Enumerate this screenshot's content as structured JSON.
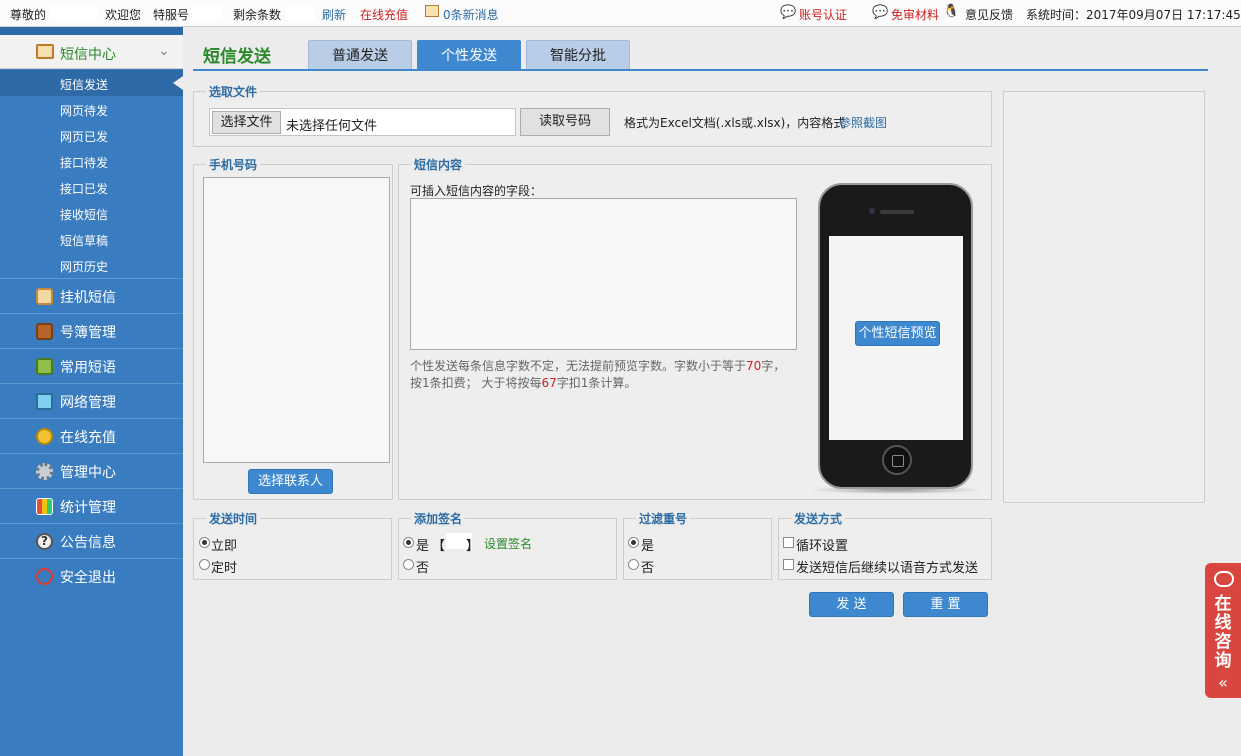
{
  "topbar": {
    "respect": "尊敬的",
    "welcome": "欢迎您",
    "service_no": "特服号",
    "remaining": "剩余条数",
    "refresh": "刷新",
    "recharge": "在线充值",
    "messages": "0条新消息",
    "account_auth": "账号认证",
    "free_material": "免审材料",
    "feedback": "意见反馈",
    "system_time_label": "系统时间：",
    "system_time": "2017年09月07日 17:17:45"
  },
  "sidebar": {
    "section": "短信中心",
    "sub_items": [
      "短信发送",
      "网页待发",
      "网页已发",
      "接口待发",
      "接口已发",
      "接收短信",
      "短信草稿",
      "网页历史"
    ],
    "menu": [
      {
        "label": "挂机短信",
        "icon": "envelope-icon"
      },
      {
        "label": "号簿管理",
        "icon": "book-icon"
      },
      {
        "label": "常用短语",
        "icon": "notepad-icon"
      },
      {
        "label": "网络管理",
        "icon": "monitor-icon"
      },
      {
        "label": "在线充值",
        "icon": "coins-icon"
      },
      {
        "label": "管理中心",
        "icon": "gear-icon"
      },
      {
        "label": "统计管理",
        "icon": "bar-chart-icon"
      },
      {
        "label": "公告信息",
        "icon": "question-icon"
      },
      {
        "label": "安全退出",
        "icon": "power-icon"
      }
    ]
  },
  "main": {
    "title": "短信发送",
    "tabs": [
      "普通发送",
      "个性发送",
      "智能分批"
    ],
    "active_tab": "个性发送",
    "file_section": {
      "legend": "选取文件",
      "choose_file": "选择文件",
      "no_file": "未选择任何文件",
      "read_numbers": "读取号码",
      "format_note": "格式为Excel文档(.xls或.xlsx)，内容格式",
      "screenshot_link": "参照截图"
    },
    "phone_section": {
      "legend": "手机号码",
      "select_contacts": "选择联系人"
    },
    "content_section": {
      "legend": "短信内容",
      "insert_label": "可插入短信内容的字段：",
      "note_line1_a": "个性发送每条信息字数不定，无法提前预览字数。字数小于等于",
      "note_70": "70",
      "note_line1_b": "字，",
      "note_line2_a": "按1条扣费； 大于将按每",
      "note_67": "67",
      "note_line2_b": "字扣1条计算。",
      "preview_button": "个性短信预览"
    },
    "send_time": {
      "legend": "发送时间",
      "options": [
        "立即",
        "定时"
      ],
      "selected": "立即"
    },
    "signature": {
      "legend": "添加签名",
      "yes": "是",
      "bracket_open": "【",
      "bracket_close": "】",
      "set_signature": "设置签名",
      "no": "否",
      "selected": "是"
    },
    "filter": {
      "legend": "过滤重号",
      "yes": "是",
      "no": "否",
      "selected": "是"
    },
    "send_mode": {
      "legend": "发送方式",
      "loop": "循环设置",
      "voice": "发送短信后继续以语音方式发送"
    },
    "send_button": "发 送",
    "reset_button": "重 置"
  },
  "consult": {
    "text": "在线咨询",
    "arrow": "«"
  },
  "colors": {
    "sidebar": "#3a7cc0",
    "accent": "#3d88cf",
    "title_green": "#2a8a2a",
    "link_blue": "#2e6da4",
    "alert_red": "#cc2222"
  }
}
